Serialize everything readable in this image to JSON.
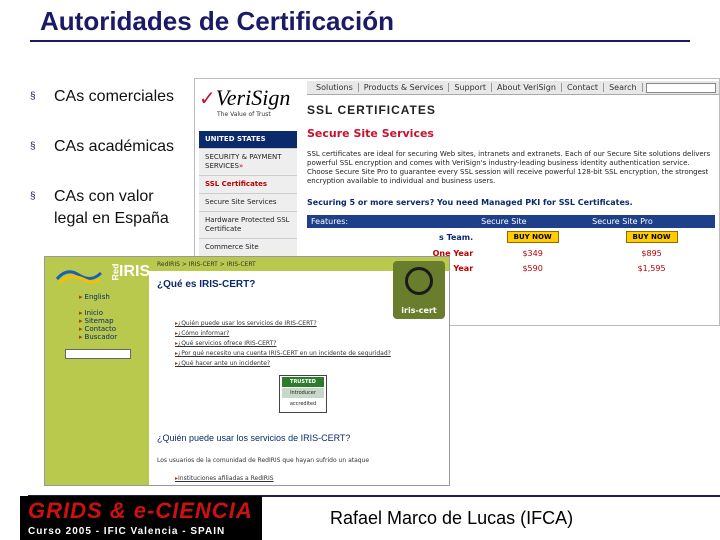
{
  "slide": {
    "title": "Autoridades de Certificación",
    "bullets": [
      {
        "line1": "CAs comerciales",
        "line2": ""
      },
      {
        "line1": "CAs académicas",
        "line2": ""
      },
      {
        "line1": "CAs con valor",
        "line2": "legal en España"
      }
    ],
    "bullet_marker": "§"
  },
  "verisign": {
    "logo_mark": "VeriSign",
    "logo_tag": "The Value of Trust",
    "nav": [
      "Solutions",
      "Products & Services",
      "Support",
      "About VeriSign",
      "Contact",
      "Search"
    ],
    "header": "SSL CERTIFICATES",
    "sidebar": [
      "UNITED STATES",
      "SECURITY & PAYMENT SERVICES",
      "SSL Certificates",
      "Secure Site Services",
      "Hardware Protected SSL Certificate",
      "Commerce Site"
    ],
    "subtitle": "Secure Site Services",
    "paragraph": "SSL certificates are ideal for securing Web sites, intranets and extranets. Each of our Secure Site solutions delivers powerful SSL encryption and comes with VeriSign's industry-leading business identity authentication service. Choose Secure Site Pro to guarantee every SSL session will receive powerful 128-bit SSL encryption, the strongest encryption available to individual and business users.",
    "managed": "Securing 5 or more servers? You need Managed PKI for SSL Certificates.",
    "table": {
      "headers": [
        "Features:",
        "Secure Site",
        "Secure Site Pro"
      ],
      "rows": [
        {
          "label": "",
          "c1": "BUY NOW",
          "c2": "BUY NOW",
          "buy": true
        },
        {
          "label": "One Year",
          "c1": "$349",
          "c2": "$895",
          "buy": false
        },
        {
          "label": "(Limited) Two Year",
          "c1": "$590",
          "c2": "$1,595",
          "buy": false
        }
      ]
    },
    "teams_text": "s Team."
  },
  "rediris": {
    "logo_red": "Red",
    "logo_iris": "IRIS",
    "side_links": [
      "English",
      "Inicio",
      "Sitemap",
      "Contacto",
      "Buscador"
    ],
    "breadcrumb": "RedIRIS > IRIS-CERT > IRIS-CERT",
    "q1": "¿Qué es IRIS-CERT?",
    "badge": "iris-cert",
    "list": [
      "¿Quién puede usar los servicios de IRIS-CERT?",
      "¿Cómo informar?",
      "¿Qué servicios ofrece IRIS-CERT?",
      "¿Por qué necesito una cuenta IRIS-CERT en un incidente de seguridad?",
      "¿Qué hacer ante un incidente?"
    ],
    "trusted": [
      "TRUSTED",
      "Introducer",
      "accredited"
    ],
    "q2": "¿Quién puede usar los servicios de IRIS-CERT?",
    "p": "Los usuarios de la comunidad de RedIRIS que hayan sufrido un ataque",
    "li2": "Instituciones afiliadas a RedIRIS"
  },
  "footer": {
    "banner_main": "GRIDS & e-CIENCIA",
    "banner_sub": "Curso 2005 - IFIC Valencia - SPAIN",
    "author": "Rafael Marco de Lucas (IFCA)"
  },
  "colors": {
    "title": "#1a1a66",
    "verisign_red": "#c8102e",
    "verisign_blue": "#1e3f8a",
    "rediris_green": "#b9c94d",
    "banner_red": "#d01010"
  }
}
